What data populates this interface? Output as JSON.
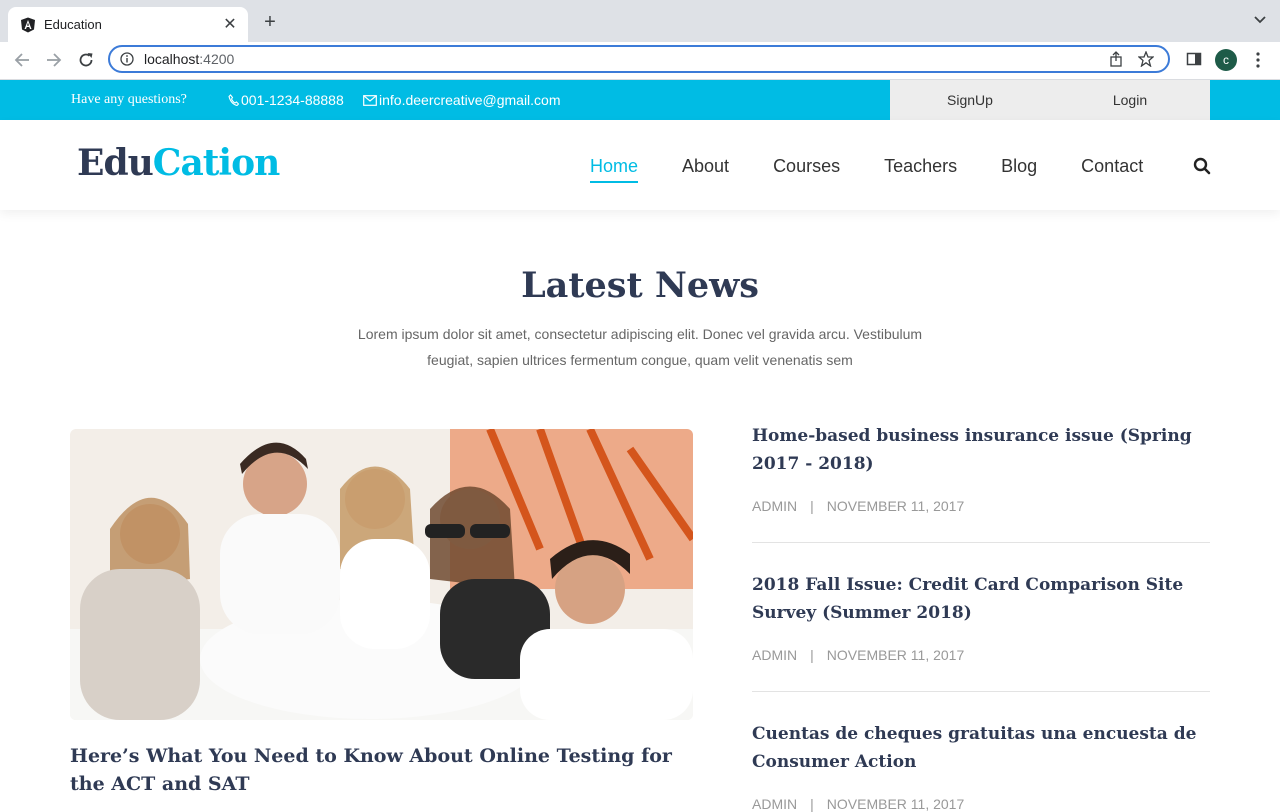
{
  "browser": {
    "tab_title": "Education",
    "url_host": "localhost",
    "url_port": ":4200",
    "profile_initial": "c"
  },
  "topbar": {
    "question": "Have any questions?",
    "phone": "001-1234-88888",
    "email": "info.deercreative@gmail.com",
    "signup": "SignUp",
    "login": "Login"
  },
  "header": {
    "logo_part1": "Edu",
    "logo_part2": "Cation",
    "menu": [
      "Home",
      "About",
      "Courses",
      "Teachers",
      "Blog",
      "Contact"
    ]
  },
  "news": {
    "title": "Latest News",
    "description": "Lorem ipsum dolor sit amet, consectetur adipiscing elit. Donec vel gravida arcu. Vestibulum feugiat, sapien ultrices fermentum congue, quam velit venenatis sem",
    "featured_title": "Here’s What You Need to Know About Online Testing for the ACT and SAT",
    "items": [
      {
        "title": "Home-based business insurance issue (Spring 2017 - 2018)",
        "author": "ADMIN",
        "sep": "|",
        "date": "NOVEMBER 11, 2017"
      },
      {
        "title": "2018 Fall Issue: Credit Card Comparison Site Survey (Summer 2018)",
        "author": "ADMIN",
        "sep": "|",
        "date": "NOVEMBER 11, 2017"
      },
      {
        "title": "Cuentas de cheques gratuitas una encuesta de Consumer Action",
        "author": "ADMIN",
        "sep": "|",
        "date": "NOVEMBER 11, 2017"
      }
    ]
  },
  "colors": {
    "accent": "#00bce4",
    "heading": "#2f3a54"
  }
}
